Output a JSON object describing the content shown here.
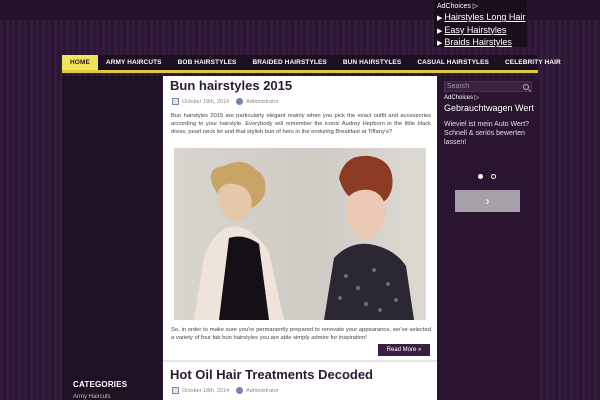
{
  "top_ad": {
    "adchoices": "AdChoices ▷",
    "links": [
      "Hairstyles Long Hair",
      "Easy Hairstyles",
      "Braids Hairstyles"
    ]
  },
  "nav": {
    "items": [
      "HOME",
      "ARMY HAIRCUTS",
      "BOB HAIRSTYLES",
      "BRAIDED HAIRSTYLES",
      "BUN HAIRSTYLES",
      "CASUAL HAIRSTYLES",
      "CELEBRITY HAIR"
    ],
    "active": 0
  },
  "post1": {
    "title": "Bun hairstyles 2015",
    "date": "October 18th, 2014",
    "author": "Administrator",
    "excerpt": "Bun hairstyles 2015 are particularly elegant mainly when you pick the exact outfit and accessories according to your hairstyle. Everybody will remember the iconic Audrey Hepburn in the little black dress, pearl neck let and that stylish bun of hers in the enduring Breakfast at Tiffany's?",
    "after": "So, in order to make sure you're permanently prepared to renovate your appearance, we've selected a variety of four fab bun hairstyles you are able simply admire for inspiration!",
    "readmore": "Read More »"
  },
  "post2": {
    "title": "Hot Oil Hair Treatments Decoded",
    "date": "October 18th, 2014",
    "author": "Administrator"
  },
  "sidebar": {
    "search_placeholder": "Search",
    "ad": {
      "adchoices": "AdChoices ▷",
      "headline": "Gebrauchtwagen Wert",
      "body": "Wieviel ist mein Auto Wert? Schnell & seriös bewerten lassen!",
      "next": "›"
    },
    "categories_title": "CATEGORIES",
    "categories_first": "Army Haircuts"
  },
  "colors": {
    "accent": "#f2e35a",
    "nav_bg": "#1c0f21",
    "page_bg": "#2f1a36",
    "button": "#3b1f42"
  }
}
